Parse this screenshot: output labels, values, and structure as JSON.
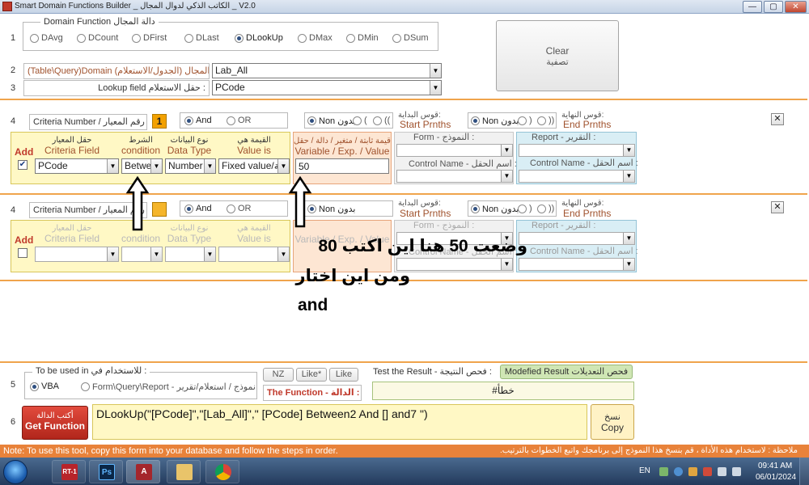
{
  "window": {
    "title": "Smart Domain Functions Builder _  الكاتب الذكي لدوال المجال  _  V2.0",
    "min": "—",
    "restore": "▢",
    "close": "✕"
  },
  "row1": {
    "num": "1",
    "legend": "Domain Function  دالة المجال",
    "options": [
      "DAvg",
      "DCount",
      "DFirst",
      "DLast",
      "DLookUp",
      "DMax",
      "DMin",
      "DSum"
    ],
    "selected": "DLookUp"
  },
  "clear": {
    "en": "Clear",
    "ar": "تصفية"
  },
  "row2": {
    "num": "2",
    "label": "(Table\\Query)Domain  المجال (الجدول/الاستعلام) :",
    "value": "Lab_All"
  },
  "row3": {
    "num": "3",
    "label": "Lookup field   حقل الاستعلام :",
    "value": "PCode"
  },
  "criteria1": {
    "num": "4",
    "label": "Criteria Number / رقم المعيار =",
    "badge": "1",
    "and": "And",
    "or": "OR",
    "start_parens": [
      "Non بدون",
      "(",
      "(("
    ],
    "start_hdr_ar": "قوس البداية:",
    "start_hdr_en": "Start Prnths",
    "end_parens": [
      "Non بدون",
      ")",
      "))"
    ],
    "end_hdr_ar": "قوس النهاية:",
    "end_hdr_en": "End Prnths",
    "x": "✕",
    "add": "Add",
    "field_ar": "حقل المعيار",
    "field_en": "Criteria Field",
    "cond_ar": "الشرط",
    "cond_en": "condition",
    "type_ar": "نوع البيانات",
    "type_en": "Data Type",
    "valis_ar": "القيمة هي",
    "valis_en": "Value is",
    "var_ar": "قيمة ثابتة / متغير / دالة / حقل",
    "var_en": "Variable / Exp. / Value",
    "form_lbl": "Form  - النموذج :",
    "report_lbl": "Report  - التقرير :",
    "ctrl_lbl": "Control Name  - اسم الحقل :",
    "checked": "✔",
    "field_val": "PCode",
    "cond_val": "Between",
    "type_val": "Number",
    "valis_val": "Fixed value/قيمة",
    "var_val": "50"
  },
  "criteria2": {
    "num": "4",
    "label": "Criteria Number / رقم المعيار",
    "and": "And",
    "or": "OR",
    "start_parens": [
      "Non بدون"
    ],
    "start_hdr_ar": "قوس البداية:",
    "start_hdr_en": "Start Prnths",
    "end_parens": [
      "Non بدون",
      ")",
      "))"
    ],
    "end_hdr_ar": "قوس النهاية:",
    "end_hdr_en": "End Prnths",
    "x": "✕",
    "add": "Add",
    "field_ar": "حقل المعيار",
    "field_en": "Criteria Field",
    "cond_en": "condition",
    "type_ar": "نوع البيانات",
    "type_en": "Data Type",
    "valis_ar": "القيمة هي",
    "valis_en": "Value is",
    "var_en": "Variable / Exp. / Value",
    "form_lbl": "Form  - النموذج :",
    "report_lbl": "Report  - التقرير :",
    "ctrl_lbl": "Control Name  - اسم الحقل :"
  },
  "annotation": {
    "line1": "وضعت 50 هنا اين اكتب 80",
    "line2": "ومن اين اختار",
    "line3": "and"
  },
  "row5": {
    "num": "5",
    "legend": "To be used in  للاستخدام في :",
    "options": [
      "VBA",
      "Form\\Query\\Report - نموذج / استعلام/تقرير"
    ],
    "selected": "VBA",
    "nz": "NZ",
    "likestar": "Like*",
    "like": "Like",
    "function_label": "The Function - الدالة :",
    "test_label": "Test the Result - فحص النتيجة :",
    "modified_btn": "Modefied Result فحص التعديلات",
    "test_value": "#خطأ"
  },
  "row6": {
    "num": "6",
    "getfn_ar": "أكتب الدالة",
    "getfn_en": "Get Function",
    "function_text": "DLookUp(\"[PCode]\",\"[Lab_All]\",\" [PCode] Between2  And [] and7 \")",
    "copy_ar": "نسخ",
    "copy_en": "Copy"
  },
  "status": {
    "left": "Note: To use this tool, copy this form into your database and follow the steps in order.",
    "right": "ملاحظة : لاستخدام هذه الأداة ، قم بنسخ هذا النموذج إلى برنامجك واتبع الخطوات بالترتيب."
  },
  "taskbar": {
    "apps": [
      "RT-1",
      "Ps",
      "A",
      "folder",
      "chrome"
    ],
    "lang": "EN",
    "time": "09:41 AM",
    "date": "06/01/2024"
  },
  "colors": {
    "accent_orange": "#f0a44c",
    "status_bar": "#e8823a",
    "yellow_panel": "#fff8c5",
    "blue_panel": "#d9eef5"
  }
}
